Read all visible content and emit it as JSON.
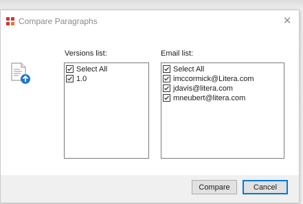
{
  "window": {
    "title": "Compare Paragraphs",
    "close_glyph": "✕"
  },
  "versions": {
    "label": "Versions list:",
    "items": [
      {
        "label": "Select All",
        "checked": true
      },
      {
        "label": "1.0",
        "checked": true
      }
    ]
  },
  "emails": {
    "label": "Email list:",
    "items": [
      {
        "label": "Select All",
        "checked": true
      },
      {
        "label": "imccormick@Litera.com",
        "checked": true
      },
      {
        "label": "jdavis@litera.com",
        "checked": true
      },
      {
        "label": "mneubert@litera.com",
        "checked": true
      }
    ]
  },
  "buttons": {
    "compare": "Compare",
    "cancel": "Cancel"
  },
  "icons": {
    "app": "litera-logo-icon",
    "document": "document-upload-icon",
    "close": "close-icon"
  },
  "colors": {
    "accent": "#0078d7",
    "logo_red": "#d13438",
    "upload_blue": "#1f77c9"
  }
}
